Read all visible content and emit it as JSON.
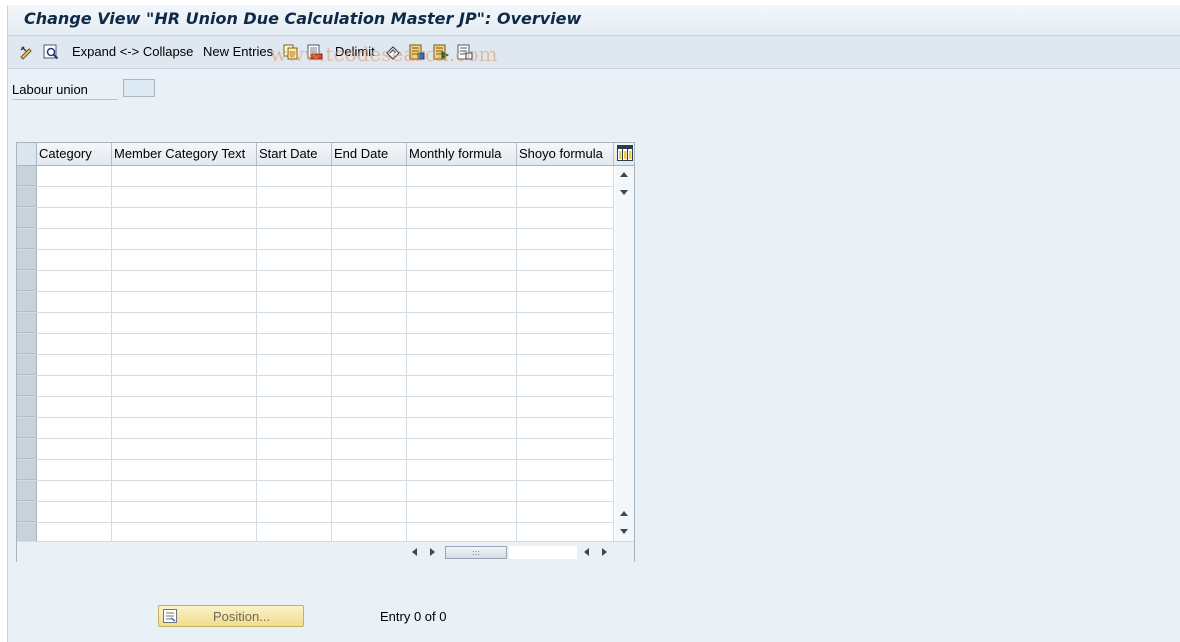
{
  "title": "Change View \"HR Union Due Calculation Master JP\": Overview",
  "toolbar": {
    "expand_collapse": "Expand <-> Collapse",
    "new_entries": "New Entries",
    "delimit": "Delimit"
  },
  "watermark": "www.tcodesearch.com",
  "field": {
    "label": "Labour union",
    "value": ""
  },
  "table": {
    "columns": [
      "Category",
      "Member Category Text",
      "Start Date",
      "End Date",
      "Monthly formula",
      "Shoyo formula"
    ],
    "rows": []
  },
  "footer": {
    "position_button": "Position...",
    "entry_count": "Entry 0 of 0"
  },
  "colors": {
    "background": "#e9f0f6",
    "title": "#0e2a46",
    "button": "#f0dd8d"
  },
  "icons": [
    "display-change-icon",
    "detail-icon",
    "copy-icon",
    "delete-icon",
    "undo-icon",
    "select-all-icon",
    "select-block-icon",
    "deselect-all-icon",
    "table-settings-icon",
    "position-icon"
  ]
}
